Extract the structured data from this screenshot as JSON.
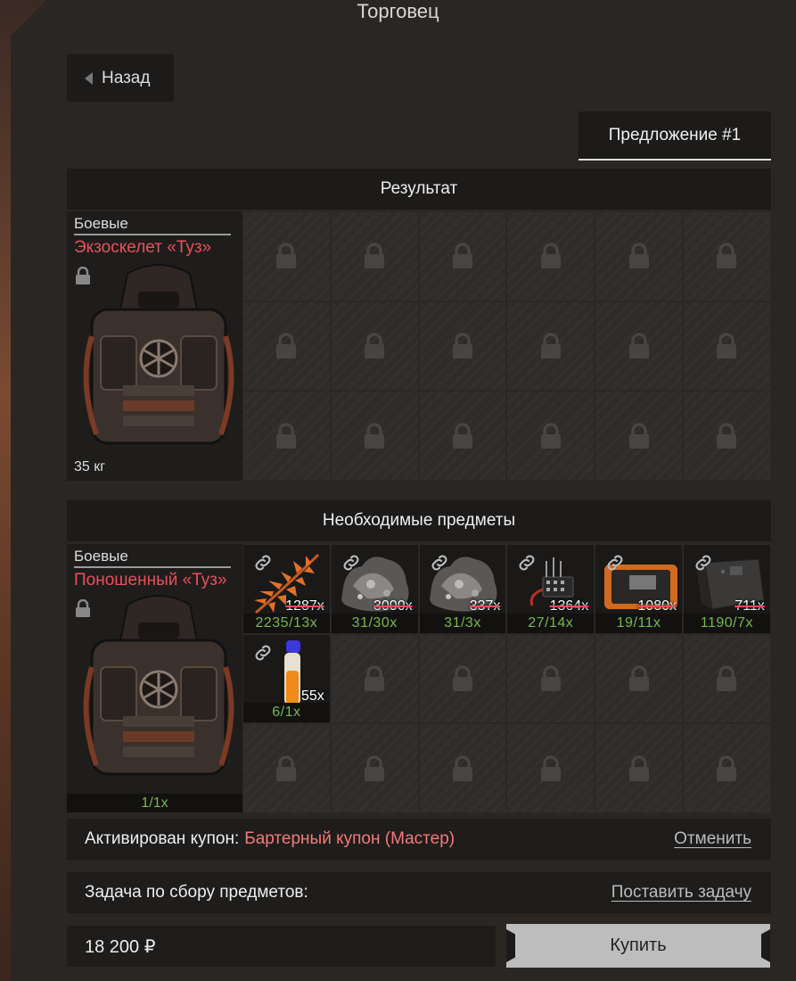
{
  "window": {
    "title": "Торговец"
  },
  "nav": {
    "back_label": "Назад"
  },
  "offer_tab": {
    "label": "Предложение #1"
  },
  "result": {
    "header": "Результат",
    "item": {
      "category": "Боевые",
      "name": "Экзоскелет «Туз»",
      "weight": "35 кг"
    }
  },
  "required": {
    "header": "Необходимые предметы",
    "item": {
      "category": "Боевые",
      "name": "Поношенный «Туз»",
      "count": "1/1x"
    },
    "slots": [
      {
        "icon": "fern-icon",
        "have": "1287x",
        "need": "2235/13x"
      },
      {
        "icon": "ore-rock-icon",
        "have": "3000x",
        "need": "31/30x"
      },
      {
        "icon": "ore-rock-icon",
        "have": "337x",
        "need": "31/3x"
      },
      {
        "icon": "circuit-board-icon",
        "have": "1364x",
        "need": "27/14x"
      },
      {
        "icon": "device-case-icon",
        "have": "1080x",
        "need": "19/11x"
      },
      {
        "icon": "battery-box-icon",
        "have": "711x",
        "need": "1190/7x"
      },
      {
        "icon": "vial-icon",
        "have": "55x",
        "need": "6/1x"
      }
    ]
  },
  "coupon": {
    "label": "Активирован купон:",
    "name": "Бартерный купон (Мастер)",
    "cancel": "Отменить"
  },
  "task": {
    "label": "Задача по сбору предметов:",
    "action": "Поставить задачу"
  },
  "purchase": {
    "price": "18 200 ₽",
    "buy_label": "Купить"
  },
  "colors": {
    "accent_red": "#e8505a",
    "ok_green": "#78b84a",
    "coupon_pink": "#f47a7a"
  }
}
